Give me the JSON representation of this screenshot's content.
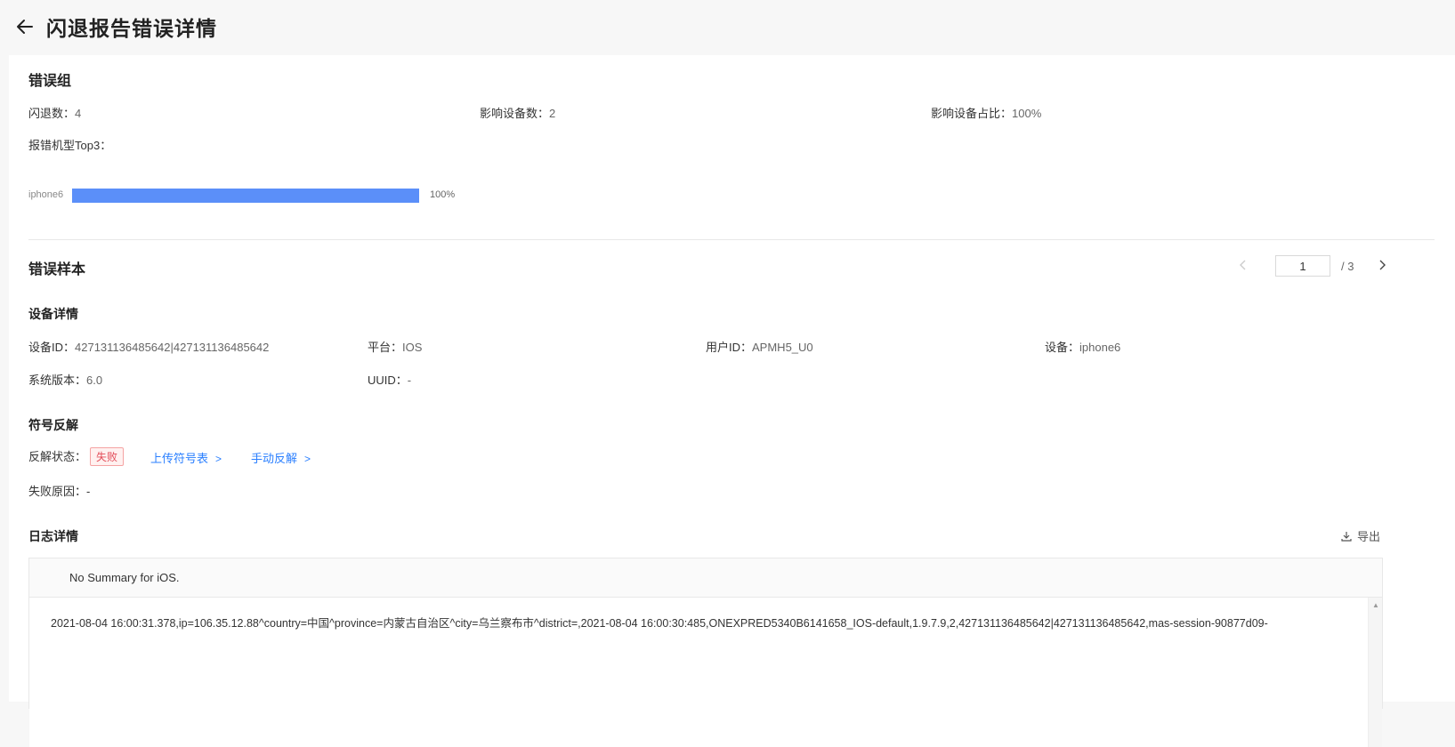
{
  "header": {
    "title": "闪退报告错误详情"
  },
  "error_group": {
    "title": "错误组",
    "crash_count_label": "闪退数：",
    "crash_count": "4",
    "affected_devices_label": "影响设备数：",
    "affected_devices": "2",
    "affected_ratio_label": "影响设备占比：",
    "affected_ratio": "100%",
    "top_models_label": "报错机型Top3：",
    "top_models": [
      {
        "name": "iphone6",
        "percent": 100,
        "percent_label": "100%"
      }
    ]
  },
  "error_sample": {
    "title": "错误样本",
    "pager": {
      "current": "1",
      "separator": "/",
      "total": "3"
    }
  },
  "device_details": {
    "title": "设备详情",
    "device_id_label": "设备ID：",
    "device_id": "427131136485642|427131136485642",
    "platform_label": "平台：",
    "platform": "IOS",
    "user_id_label": "用户ID：",
    "user_id": "APMH5_U0",
    "device_label": "设备：",
    "device": "iphone6",
    "os_version_label": "系统版本：",
    "os_version": "6.0",
    "uuid_label": "UUID：",
    "uuid": "-"
  },
  "symbolication": {
    "title": "符号反解",
    "status_label": "反解状态：",
    "status": "失败",
    "upload_link": "上传符号表",
    "manual_link": "手动反解",
    "fail_reason_label": "失败原因：",
    "fail_reason": "-"
  },
  "log": {
    "title": "日志详情",
    "export_label": "导出",
    "summary": "No Summary for iOS.",
    "line": "2021-08-04 16:00:31.378,ip=106.35.12.88^country=中国^province=内蒙古自治区^city=乌兰察布市^district=,2021-08-04 16:00:30:485,ONEXPRED5340B6141658_IOS-default,1.9.7.9,2,427131136485642|427131136485642,mas-session-90877d09-"
  }
}
